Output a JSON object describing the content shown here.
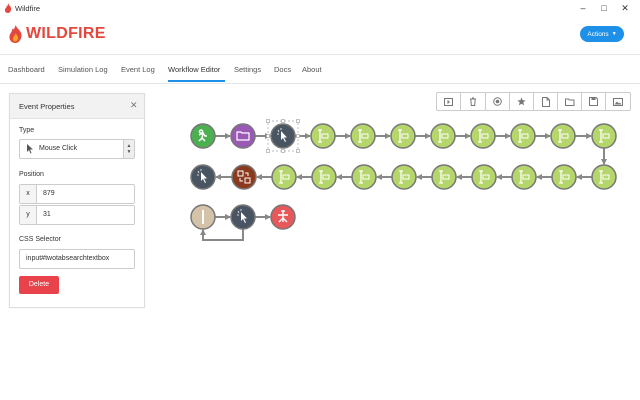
{
  "window": {
    "title": "Wildfire"
  },
  "header": {
    "logo_text": "WILDFIRE",
    "actions_label": "Actions"
  },
  "nav": {
    "items": [
      {
        "label": "Dashboard"
      },
      {
        "label": "Simulation Log"
      },
      {
        "label": "Event Log"
      },
      {
        "label": "Workflow Editor"
      },
      {
        "label": "Settings"
      },
      {
        "label": "Docs"
      },
      {
        "label": "About"
      }
    ],
    "active": "Workflow Editor"
  },
  "panel": {
    "title": "Event Properties",
    "type_label": "Type",
    "type_value": "Mouse Click",
    "position_label": "Position",
    "x_key": "x",
    "x_value": "879",
    "y_key": "y",
    "y_value": "31",
    "css_label": "CSS Selector",
    "css_value": "input#twotabsearchtextbox",
    "delete_label": "Delete"
  },
  "toolbar": {
    "icons": [
      "play-icon",
      "trash-icon",
      "record-icon",
      "star-icon",
      "new-file-icon",
      "open-folder-icon",
      "save-icon",
      "image-icon"
    ]
  },
  "workflow": {
    "nodes": [
      {
        "kind": "start",
        "color": "#4caf50"
      },
      {
        "kind": "open",
        "color": "#9b59b6"
      },
      {
        "kind": "click",
        "color": "#4a5563",
        "selected": true
      },
      {
        "kind": "input",
        "color": "#b5d66a"
      },
      {
        "kind": "input",
        "color": "#b5d66a"
      },
      {
        "kind": "input",
        "color": "#b5d66a"
      },
      {
        "kind": "input",
        "color": "#b5d66a"
      },
      {
        "kind": "input",
        "color": "#b5d66a"
      },
      {
        "kind": "input",
        "color": "#b5d66a"
      },
      {
        "kind": "input",
        "color": "#b5d66a"
      },
      {
        "kind": "input",
        "color": "#b5d66a"
      },
      {
        "kind": "input",
        "color": "#b5d66a"
      },
      {
        "kind": "input",
        "color": "#b5d66a"
      },
      {
        "kind": "input",
        "color": "#b5d66a"
      },
      {
        "kind": "input",
        "color": "#b5d66a"
      },
      {
        "kind": "input",
        "color": "#b5d66a"
      },
      {
        "kind": "input",
        "color": "#b5d66a"
      },
      {
        "kind": "input",
        "color": "#b5d66a"
      },
      {
        "kind": "input",
        "color": "#b5d66a"
      },
      {
        "kind": "input",
        "color": "#b5d66a"
      },
      {
        "kind": "tabs",
        "color": "#8b3a1e"
      },
      {
        "kind": "click",
        "color": "#4a5563"
      },
      {
        "kind": "wait",
        "color": "#d4c3a8"
      },
      {
        "kind": "click",
        "color": "#4a5563"
      },
      {
        "kind": "end",
        "color": "#e8575a"
      }
    ]
  },
  "colors": {
    "accent": "#1e90e8",
    "brand": "#e3473e",
    "delete": "#e8434b"
  }
}
